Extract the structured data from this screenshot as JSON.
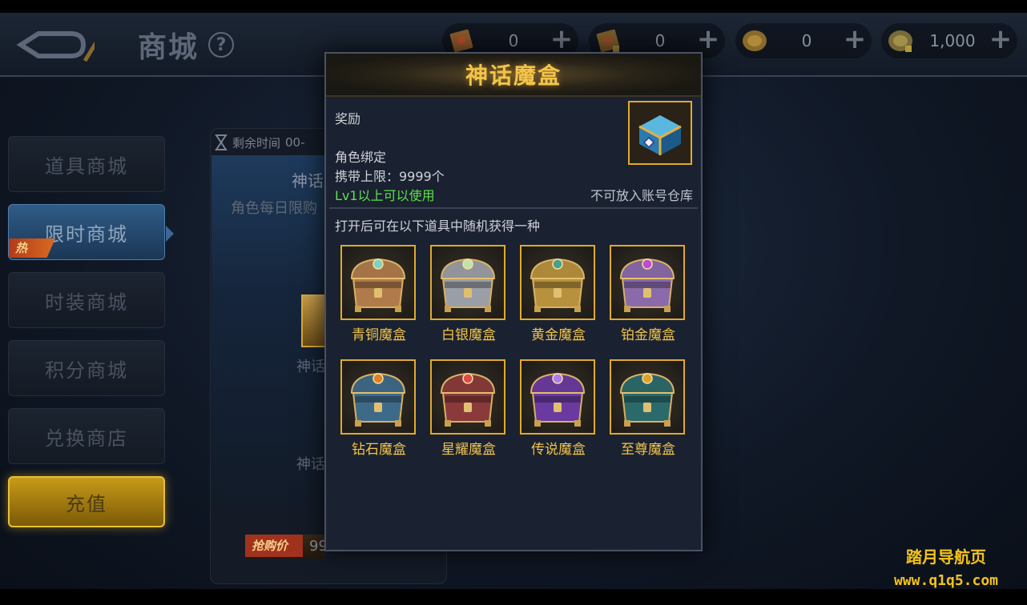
{
  "header": {
    "title": "商城",
    "help": "?"
  },
  "currencies": [
    {
      "icon": "scroll-ticket-icon",
      "value": "0"
    },
    {
      "icon": "lock-scroll-icon",
      "value": "0"
    },
    {
      "icon": "gold-coin-icon",
      "value": "0"
    },
    {
      "icon": "bound-coin-icon",
      "value": "1,000"
    }
  ],
  "sidebar": {
    "items": [
      {
        "label": "道具商城"
      },
      {
        "label": "限时商城",
        "badge": "热"
      },
      {
        "label": "时装商城"
      },
      {
        "label": "积分商城"
      },
      {
        "label": "兑换商店"
      },
      {
        "label": "充值"
      }
    ]
  },
  "background_card": {
    "timer_label": "剩余时间",
    "timer_value": "00-",
    "item_title_partial": "神话",
    "daily_limit_partial": "角色每日限购",
    "item_name_partial": "神话",
    "item_name_partial_2": "神话",
    "price_tag": "抢购价",
    "price_partial": "99"
  },
  "modal": {
    "title": "神话魔盒",
    "reward_label": "奖励",
    "binding": "角色绑定",
    "carry_limit": "携带上限：9999个",
    "usable_level": "Lv1以上可以使用",
    "no_account_storage": "不可放入账号仓库",
    "random_desc": "打开后可在以下道具中随机获得一种",
    "boxes": [
      {
        "name": "青铜魔盒",
        "color": "#b07a4a",
        "gem": "#7fd3c0"
      },
      {
        "name": "白银魔盒",
        "color": "#9a9ea6",
        "gem": "#bfe3a8"
      },
      {
        "name": "黄金魔盒",
        "color": "#b8913e",
        "gem": "#4aa08c"
      },
      {
        "name": "铂金魔盒",
        "color": "#8a6aaa",
        "gem": "#c04ad0"
      },
      {
        "name": "钻石魔盒",
        "color": "#3e6a8a",
        "gem": "#e0802a"
      },
      {
        "name": "星耀魔盒",
        "color": "#8a3a3a",
        "gem": "#e04a4a"
      },
      {
        "name": "传说魔盒",
        "color": "#6a3aa0",
        "gem": "#b07af0"
      },
      {
        "name": "至尊魔盒",
        "color": "#2a6a6a",
        "gem": "#e0a02a"
      }
    ]
  },
  "watermark": {
    "line1": "踏月导航页",
    "line2": "www.q1q5.com"
  }
}
